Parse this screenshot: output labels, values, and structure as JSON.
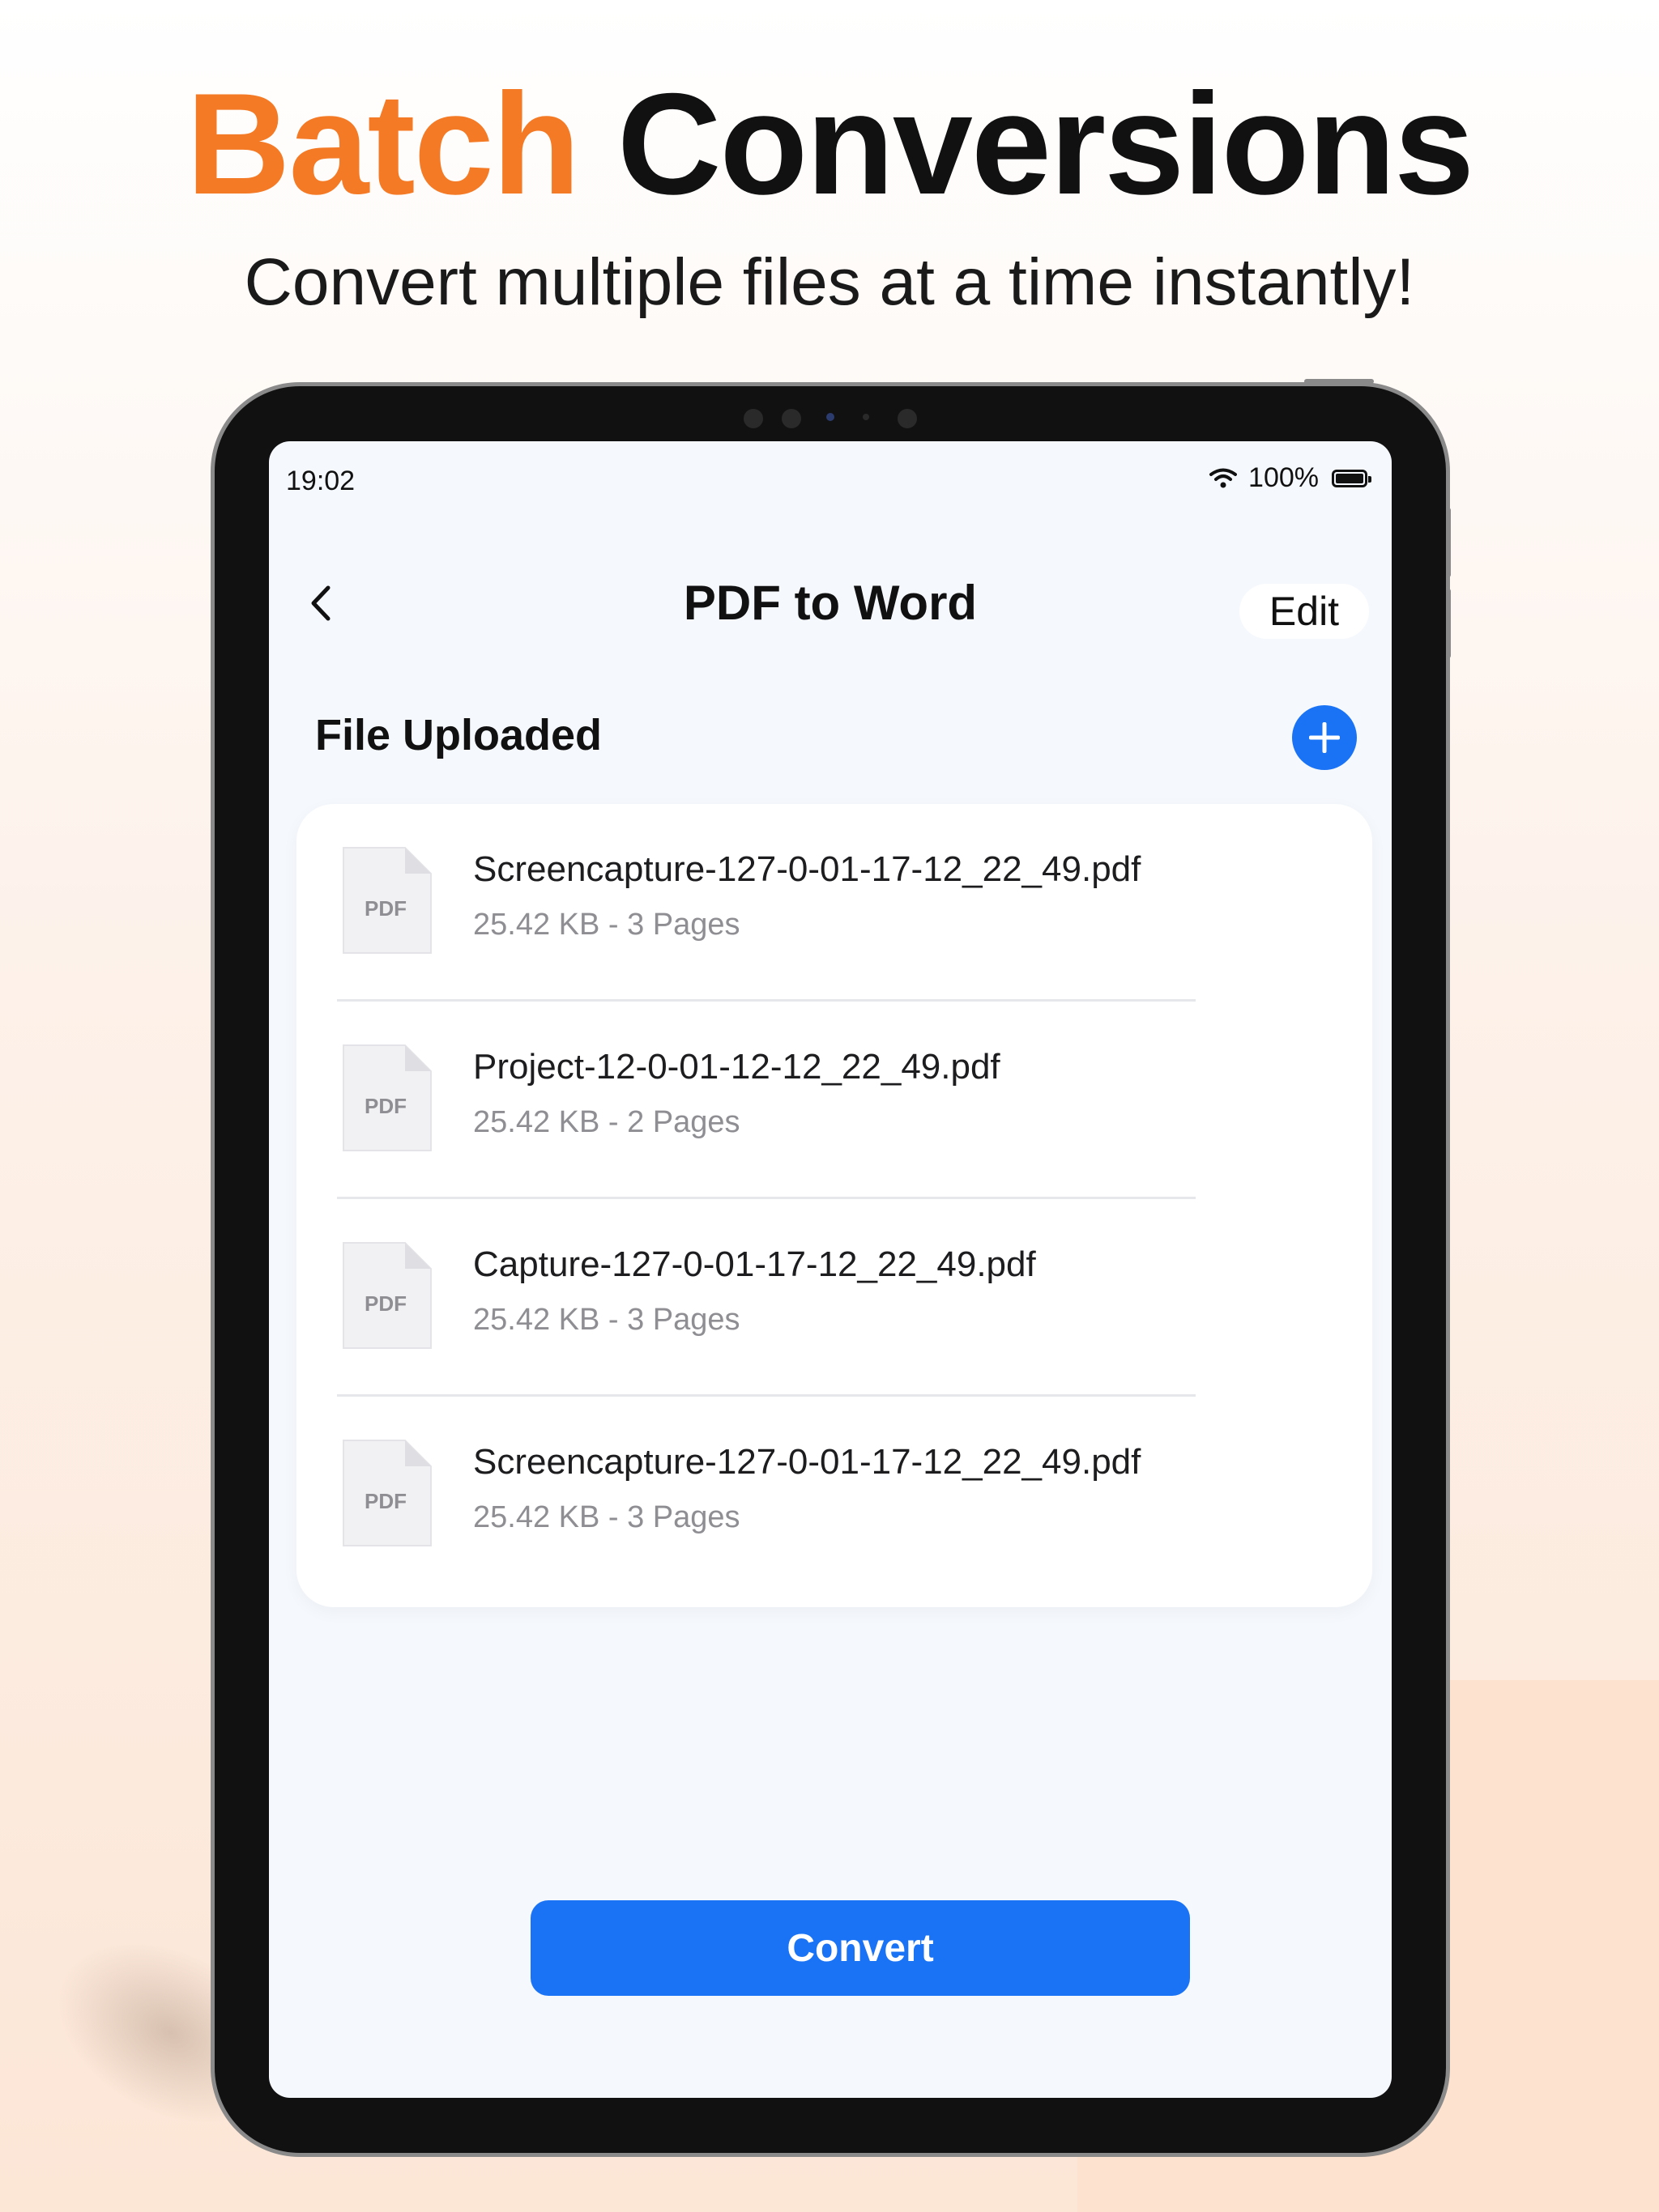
{
  "hero": {
    "title_accent": "Batch",
    "title_rest": "Conversions",
    "subtitle": "Convert multiple files at a time instantly!"
  },
  "status_bar": {
    "time": "19:02",
    "battery": "100%",
    "battery_level": 1.0
  },
  "nav": {
    "title": "PDF to Word",
    "edit_label": "Edit"
  },
  "section": {
    "title": "File Uploaded"
  },
  "files": [
    {
      "icon_label": "PDF",
      "name": "Screencapture-127-0-01-17-12_22_49.pdf",
      "meta": "25.42 KB - 3 Pages"
    },
    {
      "icon_label": "PDF",
      "name": "Project-12-0-01-12-12_22_49.pdf",
      "meta": "25.42 KB - 2 Pages"
    },
    {
      "icon_label": "PDF",
      "name": "Capture-127-0-01-17-12_22_49.pdf",
      "meta": "25.42 KB - 3 Pages"
    },
    {
      "icon_label": "PDF",
      "name": "Screencapture-127-0-01-17-12_22_49.pdf",
      "meta": "25.42 KB - 3 Pages"
    }
  ],
  "actions": {
    "convert_label": "Convert"
  },
  "colors": {
    "accent_orange": "#f47a25",
    "primary_blue": "#1a73f5",
    "screen_bg": "#f5f8fd"
  },
  "icons": {
    "back": "chevron-left-icon",
    "add": "plus-icon",
    "file": "pdf-file-icon",
    "wifi": "wifi-icon",
    "battery": "battery-icon"
  }
}
